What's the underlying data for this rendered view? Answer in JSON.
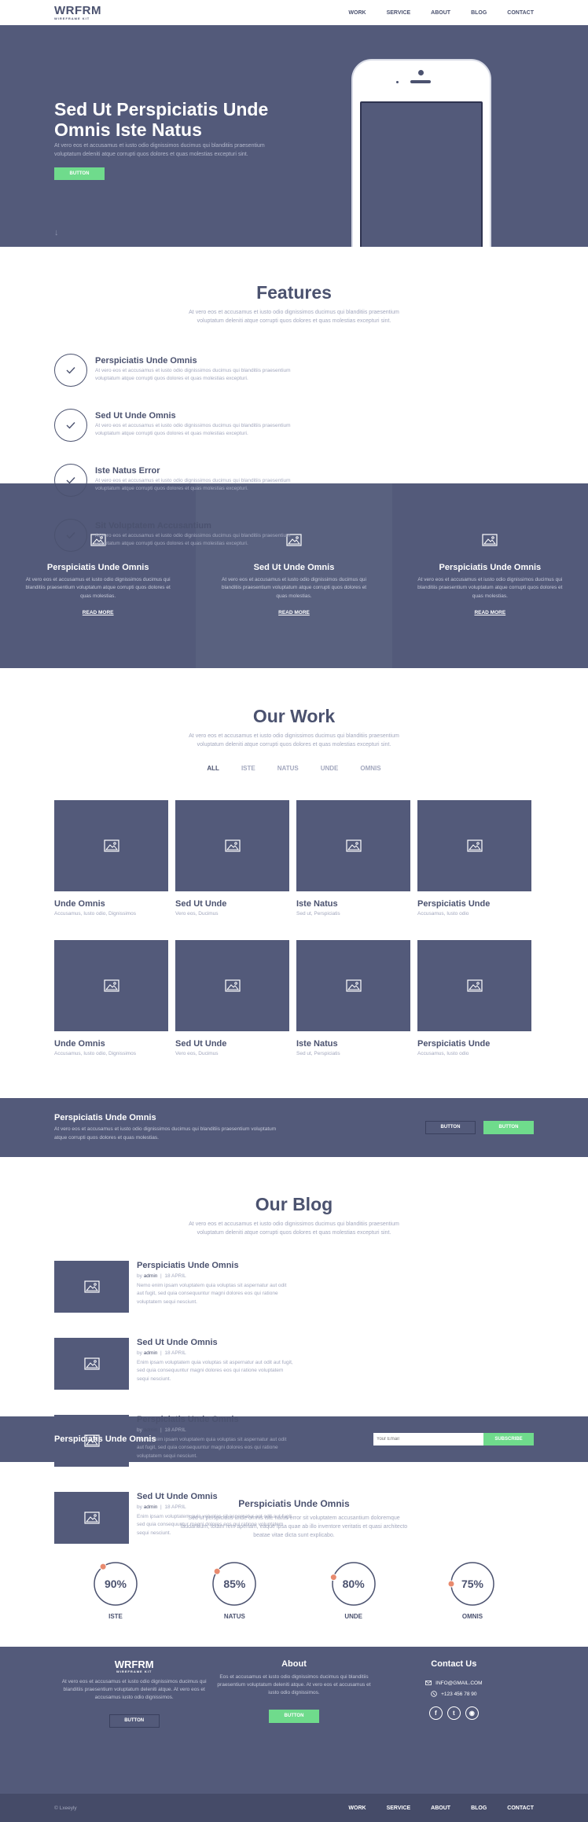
{
  "brand": {
    "name": "WRFRM",
    "tagline": "WIREFRAME KIT"
  },
  "nav": [
    "WORK",
    "SERVICE",
    "ABOUT",
    "BLOG",
    "CONTACT"
  ],
  "hero": {
    "title": "Sed Ut Perspiciatis Unde Omnis Iste Natus",
    "subtitle": "At vero eos et accusamus et iusto odio dignissimos ducimus qui blanditiis praesentium voluptatum deleniti atque corrupti quos dolores et quas molestias excepturi sint.",
    "button": "BUTTON",
    "scroll_icon": "arrow-down-icon"
  },
  "features": {
    "title": "Features",
    "description": "At vero eos et accusamus et iusto odio dignissimos ducimus qui blanditiis praesentium voluptatum deleniti atque corrupti quos dolores et quas molestias excepturi sint.",
    "items": [
      {
        "title": "Perspiciatis Unde Omnis",
        "text": "At vero eos et accusamus et iusto odio dignissimos ducimus qui blanditiis praesentium voluptatum atque corrupti quos dolores et quas molestias excepturi."
      },
      {
        "title": "Sed Ut Unde Omnis",
        "text": "At vero eos et accusamus et iusto odio dignissimos ducimus qui blanditiis praesentium voluptatum atque corrupti quos dolores et quas molestias excepturi."
      },
      {
        "title": "Iste Natus Error",
        "text": "At vero eos et accusamus et iusto odio dignissimos ducimus qui blanditiis praesentium voluptatum atque corrupti quos dolores et quas molestias excepturi."
      },
      {
        "title": "Sit Voluptatem Accusantium",
        "text": "At vero eos et accusamus et iusto odio dignissimos ducimus qui blanditiis praesentium voluptatum atque corrupti quos dolores et quas molestias excepturi."
      }
    ]
  },
  "services": [
    {
      "title": "Perspiciatis Unde Omnis",
      "text": "At vero eos et accusamus et iusto odio dignissimos ducimus qui blanditiis praesentium voluptatum atque corrupti quos dolores et quas molestias.",
      "link": "READ MORE"
    },
    {
      "title": "Sed Ut Unde Omnis",
      "text": "At vero eos et accusamus et iusto odio dignissimos ducimus qui blanditiis praesentium voluptatum atque corrupti quos dolores et quas molestias.",
      "link": "READ MORE"
    },
    {
      "title": "Perspiciatis Unde Omnis",
      "text": "At vero eos et accusamus et iusto odio dignissimos ducimus qui blanditiis praesentium voluptatum atque corrupti quos dolores et quas molestias.",
      "link": "READ MORE"
    }
  ],
  "work": {
    "title": "Our Work",
    "description": "At vero eos et accusamus et iusto odio dignissimos ducimus qui blanditiis praesentium voluptatum deleniti atque corrupti quos dolores et quas molestias excepturi sint.",
    "filters": [
      "ALL",
      "ISTE",
      "NATUS",
      "UNDE",
      "OMNIS"
    ],
    "items": [
      {
        "title": "Unde Omnis",
        "tags": "Accusamus, Iusto odio, Dignissimos"
      },
      {
        "title": "Sed Ut Unde",
        "tags": "Vero eos, Ducimus"
      },
      {
        "title": "Iste Natus",
        "tags": "Sed ut, Perspiciatis"
      },
      {
        "title": "Perspiciatis Unde",
        "tags": "Accusamus, Iusto odio"
      },
      {
        "title": "Unde Omnis",
        "tags": "Accusamus, Iusto odio, Dignissimos"
      },
      {
        "title": "Sed Ut Unde",
        "tags": "Vero eos, Ducimus"
      },
      {
        "title": "Iste Natus",
        "tags": "Sed ut, Perspiciatis"
      },
      {
        "title": "Perspiciatis Unde",
        "tags": "Accusamus, Iusto odio"
      }
    ]
  },
  "cta": {
    "title": "Perspiciatis Unde Omnis",
    "text": "At vero eos et accusamus et iusto odio dignissimos ducimus qui blanditiis praesentium voluptatum atque corrupti quos dolores et quas molestias.",
    "button_outline": "BUTTON",
    "button_green": "BUTTON"
  },
  "blog": {
    "title": "Our Blog",
    "description": "At vero eos et accusamus et iusto odio dignissimos ducimus qui blanditiis praesentium voluptatum deleniti atque corrupti quos dolores et quas molestias excepturi sint.",
    "by": "by",
    "posts": [
      {
        "title": "Perspiciatis Unde Omnis",
        "author": "admin",
        "date": "18 APRIL",
        "text": "Nemo enim ipsam voluptatem quia voluptas sit aspernatur aut odit aut fugit, sed quia consequuntur magni dolores eos qui ratione voluptatem sequi nesciunt."
      },
      {
        "title": "Sed Ut Unde Omnis",
        "author": "admin",
        "date": "18 APRIL",
        "text": "Enim ipsam voluptatem quia voluptas sit aspernatur aut odit aut fugit, sed quia consequuntur magni dolores eos qui ratione voluptatem sequi nesciunt."
      },
      {
        "title": "Perspiciatis Unde Omnis",
        "author": "admin",
        "date": "18 APRIL",
        "text": "Nemo enim ipsam voluptatem quia voluptas sit aspernatur aut odit aut fugit, sed quia consequuntur magni dolores eos qui ratione voluptatem sequi nesciunt."
      },
      {
        "title": "Sed Ut Unde Omnis",
        "author": "admin",
        "date": "18 APRIL",
        "text": "Enim ipsam voluptatem quia voluptas sit aspernatur aut odit aut fugit, sed quia consequuntur magni dolores eos qui ratione voluptatem sequi nesciunt."
      }
    ]
  },
  "subscribe": {
    "title": "Perspiciatis Unde Omnis",
    "placeholder": "Your Email",
    "button": "SUBSCRIBE"
  },
  "skills": {
    "title": "Perspiciatis Unde Omnis",
    "description": "Sed ut perspiciatis unde omnis iste natus error sit voluptatem accusantium doloremque laudantium, totam rem aperiam, eaque ipsa quae ab illo inventore veritatis et quasi architecto beatae vitae dicta sunt explicabo.",
    "items": [
      {
        "label": "ISTE",
        "percent": 90,
        "display": "90%"
      },
      {
        "label": "NATUS",
        "percent": 85,
        "display": "85%"
      },
      {
        "label": "UNDE",
        "percent": 80,
        "display": "80%"
      },
      {
        "label": "OMNIS",
        "percent": 75,
        "display": "75%"
      }
    ]
  },
  "footer": {
    "about_text": "At vero eos et accusamus et iusto odio dignissimos ducimus qui blanditiis praesentium voluptatum deleniti atque. At vero eos et accusamus iusto odio dignissimos.",
    "about_button": "BUTTON",
    "about_title": "About",
    "about_col_text": "Eos et accusamus et iusto odio dignissimos ducimus qui blanditiis praesentium voluptatum deleniti atque. At vero eos et accusamus et iusto odio dignissimos.",
    "about_col_button": "BUTTON",
    "contact_title": "Contact Us",
    "email": "INFO@GMAIL.COM",
    "phone": "+123 456 78 90",
    "socials": [
      "facebook-icon",
      "twitter-icon",
      "instagram-icon"
    ],
    "copyright": "© Lxeeyly"
  },
  "colors": {
    "primary": "#535a7a",
    "accent": "#6fdb8c",
    "text": "#4b526f",
    "muted": "#a3a8be",
    "progress_dot": "#e88a6e"
  }
}
